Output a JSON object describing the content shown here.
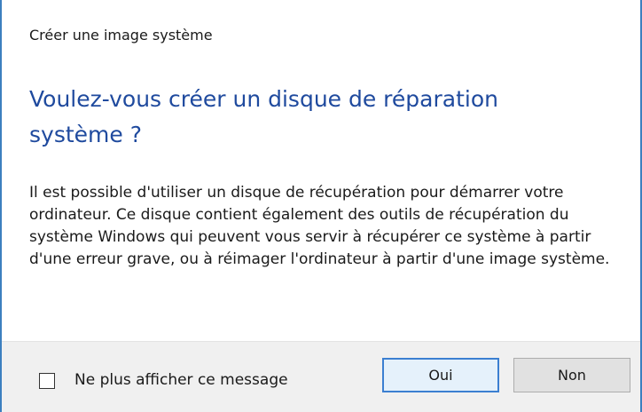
{
  "dialog": {
    "title": "Créer une image système",
    "heading": "Voulez-vous créer un disque de réparation système ?",
    "body": "Il est possible d'utiliser un disque de récupération pour démarrer votre ordinateur. Ce disque contient également des outils de récupération du système Windows qui peuvent vous servir à récupérer ce système à partir d'une erreur grave, ou à réimager l'ordinateur à partir d'une image système.",
    "checkbox_label": "Ne plus afficher ce message",
    "checkbox_checked": false,
    "yes_label": "Oui",
    "no_label": "Non"
  },
  "colors": {
    "heading": "#1f4a9e",
    "window_border": "#3c7fbf",
    "footer_bg": "#f0f0f0",
    "default_button_border": "#3b7fd1"
  }
}
